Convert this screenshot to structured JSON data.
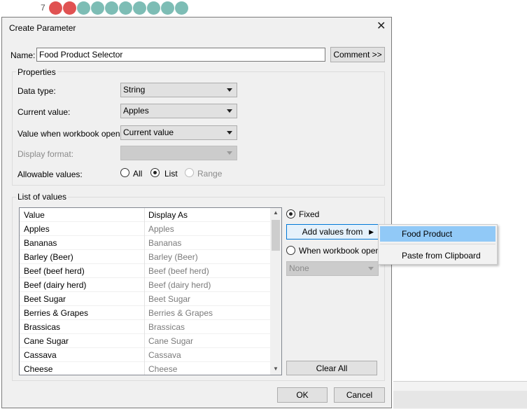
{
  "background": {
    "row_label": "7",
    "dot_colors": [
      "#e05252",
      "#e05252",
      "#7dbdb5",
      "#7dbdb5",
      "#7dbdb5",
      "#7dbdb5",
      "#7dbdb5",
      "#7dbdb5",
      "#7dbdb5",
      "#7dbdb5"
    ]
  },
  "dialog": {
    "title": "Create Parameter",
    "close_icon": "close-icon",
    "name_label": "Name:",
    "name_value": "Food Product Selector",
    "comment_button": "Comment >>",
    "properties": {
      "title": "Properties",
      "data_type_label": "Data type:",
      "data_type_value": "String",
      "current_value_label": "Current value:",
      "current_value_value": "Apples",
      "workbook_opens_label": "Value when workbook opens:",
      "workbook_opens_value": "Current value",
      "display_format_label": "Display format:",
      "display_format_value": "",
      "allowable_label": "Allowable values:",
      "allowable_options": [
        "All",
        "List",
        "Range"
      ],
      "allowable_selected": "List"
    },
    "list_of_values": {
      "title": "List of values",
      "columns": [
        "Value",
        "Display As"
      ],
      "rows": [
        {
          "value": "Apples",
          "display": "Apples"
        },
        {
          "value": "Bananas",
          "display": "Bananas"
        },
        {
          "value": "Barley (Beer)",
          "display": "Barley (Beer)"
        },
        {
          "value": "Beef (beef herd)",
          "display": "Beef (beef herd)"
        },
        {
          "value": "Beef (dairy herd)",
          "display": "Beef (dairy herd)"
        },
        {
          "value": "Beet Sugar",
          "display": "Beet Sugar"
        },
        {
          "value": "Berries & Grapes",
          "display": "Berries & Grapes"
        },
        {
          "value": "Brassicas",
          "display": "Brassicas"
        },
        {
          "value": "Cane Sugar",
          "display": "Cane Sugar"
        },
        {
          "value": "Cassava",
          "display": "Cassava"
        },
        {
          "value": "Cheese",
          "display": "Cheese"
        }
      ],
      "fixed_label": "Fixed",
      "add_values_button": "Add values from",
      "when_opens_label": "When workbook opens",
      "source_select_value": "None",
      "clear_all_button": "Clear All"
    },
    "ok_button": "OK",
    "cancel_button": "Cancel"
  },
  "context_menu": {
    "items": [
      "Food Product",
      "Paste from Clipboard"
    ],
    "highlighted": "Food Product"
  }
}
